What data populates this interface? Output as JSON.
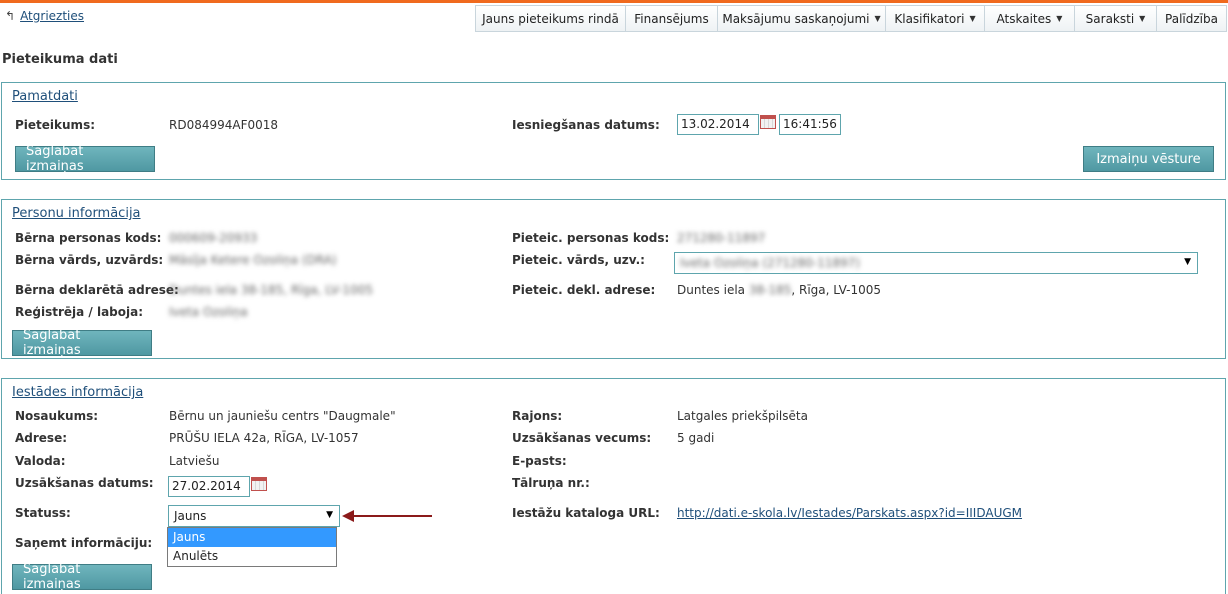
{
  "topbar": {
    "back_label": "Atgriezties",
    "nav": [
      {
        "label": "Jauns pieteikums rindā",
        "caret": false
      },
      {
        "label": "Finansējums",
        "caret": false
      },
      {
        "label": "Maksājumu saskaņojumi",
        "caret": true
      },
      {
        "label": "Klasifikatori",
        "caret": true
      },
      {
        "label": "Atskaites",
        "caret": true
      },
      {
        "label": "Saraksti",
        "caret": true
      },
      {
        "label": "Palīdzība",
        "caret": false
      }
    ]
  },
  "page_title": "Pieteikuma dati",
  "pamatdati": {
    "title": "Pamatdati",
    "pieteikums_label": "Pieteikums:",
    "pieteikums_value": "RD084994AF0018",
    "iesniegsanas_label": "Iesniegšanas datums:",
    "date_value": "13.02.2014",
    "time_value": "16:41:56",
    "save_label": "Saglabāt izmaiņas",
    "history_label": "Izmaiņu vēsture"
  },
  "personu": {
    "title": "Personu informācija",
    "berna_kods_label": "Bērna personas kods:",
    "berna_kods_value": "000609-20933",
    "berna_vards_label": "Bērna vārds, uzvārds:",
    "berna_vards_value": "Māsīja Ketere Ozoliņa (DRA)",
    "berna_adrese_label": "Bērna deklarētā adrese:",
    "berna_adrese_value": "Duntes iela 38-185, Rīga, LV-1005",
    "registreja_label": "Reģistrēja / laboja:",
    "registreja_value": "Iveta Ozoliņa",
    "pieteic_kods_label": "Pieteic. personas kods:",
    "pieteic_kods_value": "271280-11897",
    "pieteic_vards_label": "Pieteic. vārds, uzv.:",
    "pieteic_vards_value": "Iveta Ozoliņa (271280-11897)",
    "pieteic_adrese_label": "Pieteic. dekl. adrese:",
    "pieteic_adrese_prefix": "Duntes iela",
    "pieteic_adrese_hidden": "38-185",
    "pieteic_adrese_suffix": ", Rīga, LV-1005",
    "save_label": "Saglabāt izmaiņas"
  },
  "iestades": {
    "title": "Iestādes informācija",
    "nosaukums_label": "Nosaukums:",
    "nosaukums_value": "Bērnu un jauniešu centrs \"Daugmale\"",
    "adrese_label": "Adrese:",
    "adrese_value": "PRŪŠU IELA 42a, RĪGA, LV-1057",
    "valoda_label": "Valoda:",
    "valoda_value": "Latviešu",
    "uzsaksanas_datums_label": "Uzsākšanas datums:",
    "uzsaksanas_datums_value": "27.02.2014",
    "statuss_label": "Statuss:",
    "statuss_value": "Jauns",
    "statuss_options": [
      "Jauns",
      "Anulēts"
    ],
    "sanemt_label": "Saņemt informāciju:",
    "rajons_label": "Rajons:",
    "rajons_value": "Latgales priekšpilsēta",
    "vecums_label": "Uzsākšanas vecums:",
    "vecums_value": "5 gadi",
    "epasts_label": "E-pasts:",
    "talrunis_label": "Tālruņa nr.:",
    "url_label": "Iestāžu kataloga URL:",
    "url_value": "http://dati.e-skola.lv/Iestades/Parskats.aspx?id=IIIDAUGM",
    "save_label": "Saglabāt izmaiņas"
  },
  "colors": {
    "accent_top": "#f06a1e",
    "panel_border": "#5ea5ad",
    "button": "#5aa3ac",
    "arrow": "#8b1a1a",
    "selected_option": "#3399ff"
  }
}
